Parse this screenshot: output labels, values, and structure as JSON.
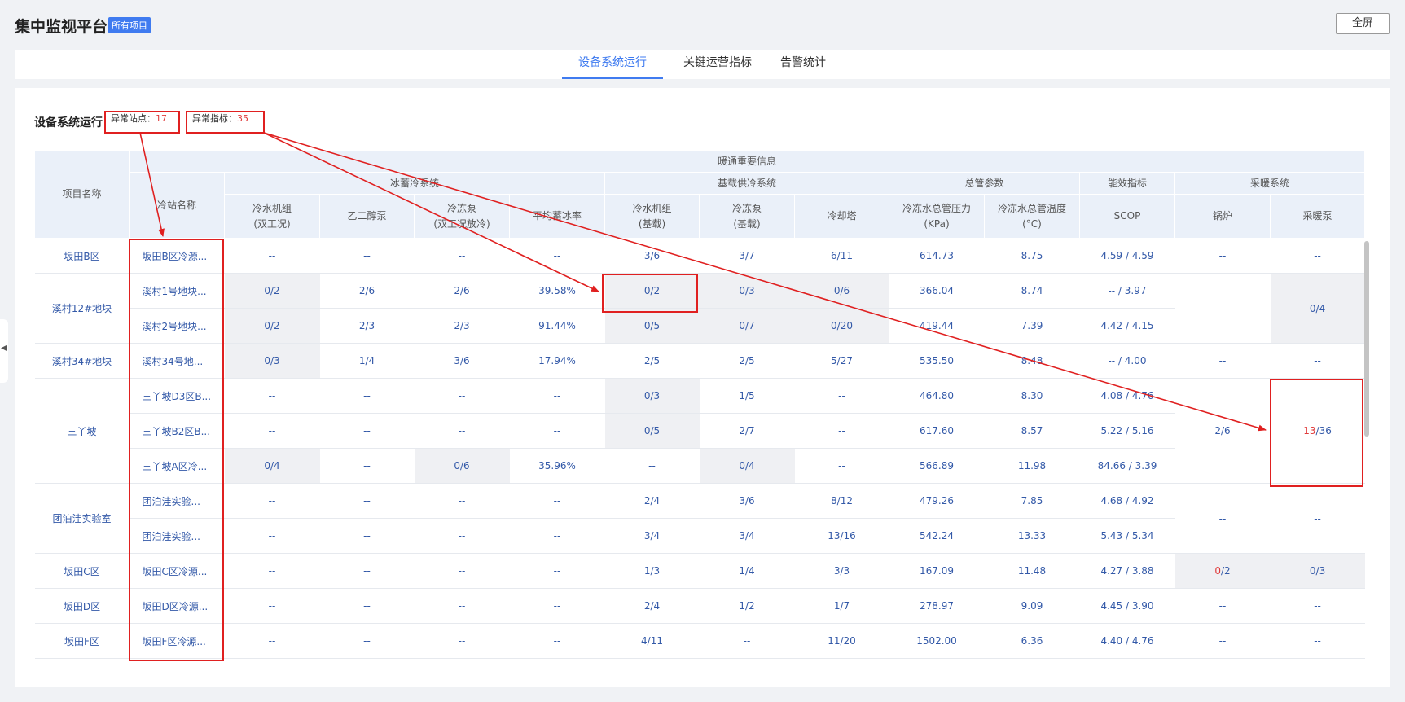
{
  "header": {
    "title": "集中监视平台",
    "badge": "所有项目",
    "fullscreen_label": "全屏"
  },
  "tabs": [
    {
      "label": "设备系统运行",
      "active": true
    },
    {
      "label": "关键运营指标",
      "active": false
    },
    {
      "label": "告警统计",
      "active": false
    }
  ],
  "section": {
    "title": "设备系统运行",
    "abnormal_sites_label": "异常站点：",
    "abnormal_sites_value": "17",
    "abnormal_metrics_label": "异常指标：",
    "abnormal_metrics_value": "35"
  },
  "table": {
    "col_project": "项目名称",
    "col_station": "冷站名称",
    "group_top": "暖通重要信息",
    "groups": [
      "冰蓄冷系统",
      "基载供冷系统",
      "总管参数",
      "能效指标",
      "采暖系统"
    ],
    "cols": [
      [
        "冷水机组",
        "(双工况)"
      ],
      [
        "乙二醇泵",
        ""
      ],
      [
        "冷冻泵",
        "(双工况放冷)"
      ],
      [
        "平均蓄冰率",
        ""
      ],
      [
        "冷水机组",
        "(基载)"
      ],
      [
        "冷冻泵",
        "(基载)"
      ],
      [
        "冷却塔",
        ""
      ],
      [
        "冷冻水总管压力",
        "(KPa)"
      ],
      [
        "冷冻水总管温度",
        "(°C)"
      ],
      [
        "SCOP",
        ""
      ],
      [
        "锅炉",
        ""
      ],
      [
        "采暖泵",
        ""
      ]
    ],
    "projects": [
      "坂田B区",
      "溪村12#地块",
      "溪村34#地块",
      "三丫坡",
      "团泊洼实验室",
      "坂田C区",
      "坂田D区",
      "坂田F区"
    ],
    "rows": [
      {
        "name": "坂田B区冷源...",
        "c": [
          "--",
          "--",
          "--",
          "--",
          "3/6",
          "3/7",
          "6/11",
          "614.73",
          "8.75",
          "4.59 / 4.59"
        ]
      },
      {
        "name": "溪村1号地块...",
        "c": [
          "0/2",
          "2/6",
          "2/6",
          "39.58%",
          "0/2",
          "0/3",
          "0/6",
          "366.04",
          "8.74",
          "-- / 3.97"
        ]
      },
      {
        "name": "溪村2号地块...",
        "c": [
          "0/2",
          "2/3",
          "2/3",
          "91.44%",
          "0/5",
          "0/7",
          "0/20",
          "419.44",
          "7.39",
          "4.42 / 4.15"
        ]
      },
      {
        "name": "溪村34号地...",
        "c": [
          "0/3",
          "1/4",
          "3/6",
          "17.94%",
          "2/5",
          "2/5",
          "5/27",
          "535.50",
          "8.48",
          "-- / 4.00"
        ]
      },
      {
        "name": "三丫坡D3区B...",
        "c": [
          "--",
          "--",
          "--",
          "--",
          "0/3",
          "1/5",
          "--",
          "464.80",
          "8.30",
          "4.08 / 4.76"
        ]
      },
      {
        "name": "三丫坡B2区B...",
        "c": [
          "--",
          "--",
          "--",
          "--",
          "0/5",
          "2/7",
          "--",
          "617.60",
          "8.57",
          "5.22 / 5.16"
        ]
      },
      {
        "name": "三丫坡A区冷...",
        "c": [
          "0/4",
          "--",
          "0/6",
          "35.96%",
          "--",
          "0/4",
          "--",
          "566.89",
          "11.98",
          "84.66 / 3.39"
        ]
      },
      {
        "name": "团泊洼实验...",
        "c": [
          "--",
          "--",
          "--",
          "--",
          "2/4",
          "3/6",
          "8/12",
          "479.26",
          "7.85",
          "4.68 / 4.92"
        ]
      },
      {
        "name": "团泊洼实验...",
        "c": [
          "--",
          "--",
          "--",
          "--",
          "3/4",
          "3/4",
          "13/16",
          "542.24",
          "13.33",
          "5.43 / 5.34"
        ]
      },
      {
        "name": "坂田C区冷源...",
        "c": [
          "--",
          "--",
          "--",
          "--",
          "1/3",
          "1/4",
          "3/3",
          "167.09",
          "11.48",
          "4.27 / 3.88"
        ]
      },
      {
        "name": "坂田D区冷源...",
        "c": [
          "--",
          "--",
          "--",
          "--",
          "2/4",
          "1/2",
          "1/7",
          "278.97",
          "9.09",
          "4.45 / 3.90"
        ]
      },
      {
        "name": "坂田F区冷源...",
        "c": [
          "--",
          "--",
          "--",
          "--",
          "4/11",
          "--",
          "11/20",
          "1502.00",
          "6.36",
          "4.40 / 4.76"
        ]
      }
    ],
    "heating": {
      "r0_boiler": "--",
      "r0_pump": "--",
      "r12_boiler": "--",
      "r12_pump": "0/4",
      "r3_boiler": "--",
      "r3_pump": "--",
      "r456_boiler": "2/6",
      "r456_pump_abn": "13",
      "r456_pump_rest": "/36",
      "r78_boiler": "--",
      "r78_pump": "--",
      "r9_boiler_abn": "0",
      "r9_boiler_rest": "/2",
      "r9_pump": "0/3",
      "r10_boiler": "--",
      "r10_pump": "--",
      "r11_boiler": "--",
      "r11_pump": "--"
    }
  },
  "colors": {
    "accent": "#3f7bf0",
    "annotation": "#e02020",
    "abnormal": "#e03a3a"
  }
}
